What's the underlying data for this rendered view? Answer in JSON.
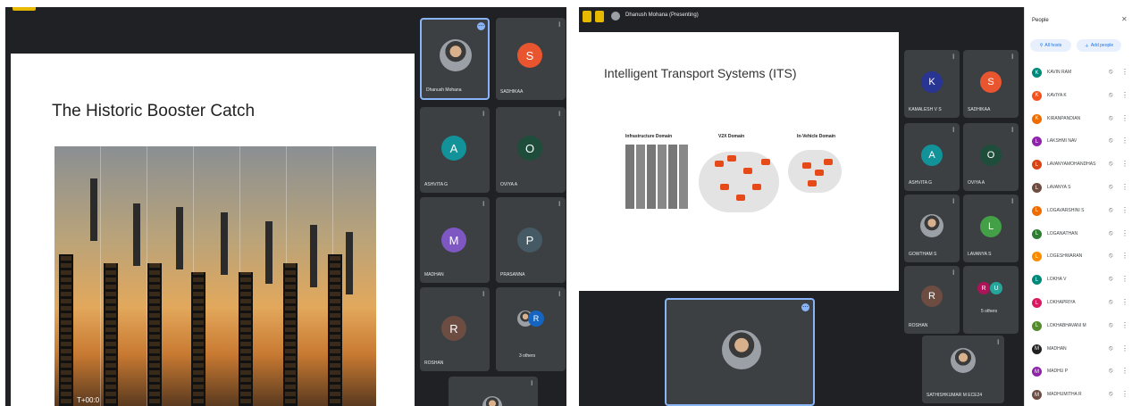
{
  "left": {
    "slide_title": "The Historic Booster Catch",
    "timer": "T+00:0",
    "self_tile": {
      "name": "Dhanush Mohana"
    },
    "tiles": [
      {
        "id": "sadhikaa",
        "name": "SADHIKAA",
        "initial": "S",
        "color": "#e8552f"
      },
      {
        "id": "ashvita",
        "name": "ASHVITA G",
        "initial": "A",
        "color": "#12939a"
      },
      {
        "id": "oviya",
        "name": "OVIYA A",
        "initial": "O",
        "color": "#1e4d3b"
      },
      {
        "id": "madhan",
        "name": "MADHAN",
        "initial": "M",
        "color": "#7e57c2"
      },
      {
        "id": "prasanna",
        "name": "PRASANNA",
        "initial": "P",
        "color": "#455a64"
      },
      {
        "id": "roshan",
        "name": "ROSHAN",
        "initial": "R",
        "color": "#6d4c41"
      },
      {
        "id": "others",
        "name": "3 others",
        "initial": "R",
        "color": "#1565c0"
      }
    ]
  },
  "right": {
    "header_title": "Dhanush Mohana (Presenting)",
    "slide_title": "Intelligent Transport Systems (ITS)",
    "domains": [
      "Infrastructure Domain",
      "V2X Domain",
      "In-Vehicle Domain"
    ],
    "tiles": [
      {
        "id": "kamalesh",
        "name": "KAMALESH V S",
        "initial": "K",
        "color": "#283593"
      },
      {
        "id": "sadhikaa",
        "name": "SADHIKAA",
        "initial": "S",
        "color": "#e8552f"
      },
      {
        "id": "ashvita",
        "name": "ASHVITA G",
        "initial": "A",
        "color": "#12939a"
      },
      {
        "id": "oviya",
        "name": "OVIYA A",
        "initial": "O",
        "color": "#1e4d3b"
      },
      {
        "id": "gowtham",
        "name": "GOWTHAM S",
        "initial": "",
        "color": "#555"
      },
      {
        "id": "lavanya",
        "name": "LAVANYA S",
        "initial": "L",
        "color": "#43a047"
      },
      {
        "id": "roshan",
        "name": "ROSHAN",
        "initial": "R",
        "color": "#6d4c41"
      },
      {
        "id": "others",
        "name": "5 others",
        "initial": "R",
        "color": "#ad1457"
      },
      {
        "id": "sathish",
        "name": "SATHISHKUMAR M ECE24",
        "initial": "",
        "color": "#777"
      }
    ],
    "people_panel": {
      "title": "People",
      "add_people": "Add people",
      "all_hosts": "All hosts",
      "participants": [
        {
          "name": "KAVIN RAM",
          "initial": "K",
          "color": "#00897b"
        },
        {
          "name": "KAVIYA K",
          "initial": "K",
          "color": "#f4511e"
        },
        {
          "name": "KIRANPANDIAN",
          "initial": "K",
          "color": "#ef6c00"
        },
        {
          "name": "LAKSHMI NAV",
          "initial": "L",
          "color": "#8e24aa"
        },
        {
          "name": "LAVANYAMOHANDHAS",
          "initial": "L",
          "color": "#d84315"
        },
        {
          "name": "LAVANYA S",
          "initial": "L",
          "color": "#6d4c41"
        },
        {
          "name": "LOGAVARSHINI S",
          "initial": "L",
          "color": "#ef6c00"
        },
        {
          "name": "LOGANATHAN",
          "initial": "L",
          "color": "#2e7d32"
        },
        {
          "name": "LOGESHWARAN",
          "initial": "L",
          "color": "#fb8c00"
        },
        {
          "name": "LOKHA V",
          "initial": "L",
          "color": "#00897b"
        },
        {
          "name": "LOKHAPRIYA",
          "initial": "L",
          "color": "#d81b60"
        },
        {
          "name": "LOKHABHAVANI M",
          "initial": "L",
          "color": "#558b2f"
        },
        {
          "name": "MADHAN",
          "initial": "M",
          "color": "#212121"
        },
        {
          "name": "MADHU P",
          "initial": "M",
          "color": "#8e24aa"
        },
        {
          "name": "MADHUMITHA R",
          "initial": "M",
          "color": "#6d4c41"
        }
      ]
    }
  }
}
